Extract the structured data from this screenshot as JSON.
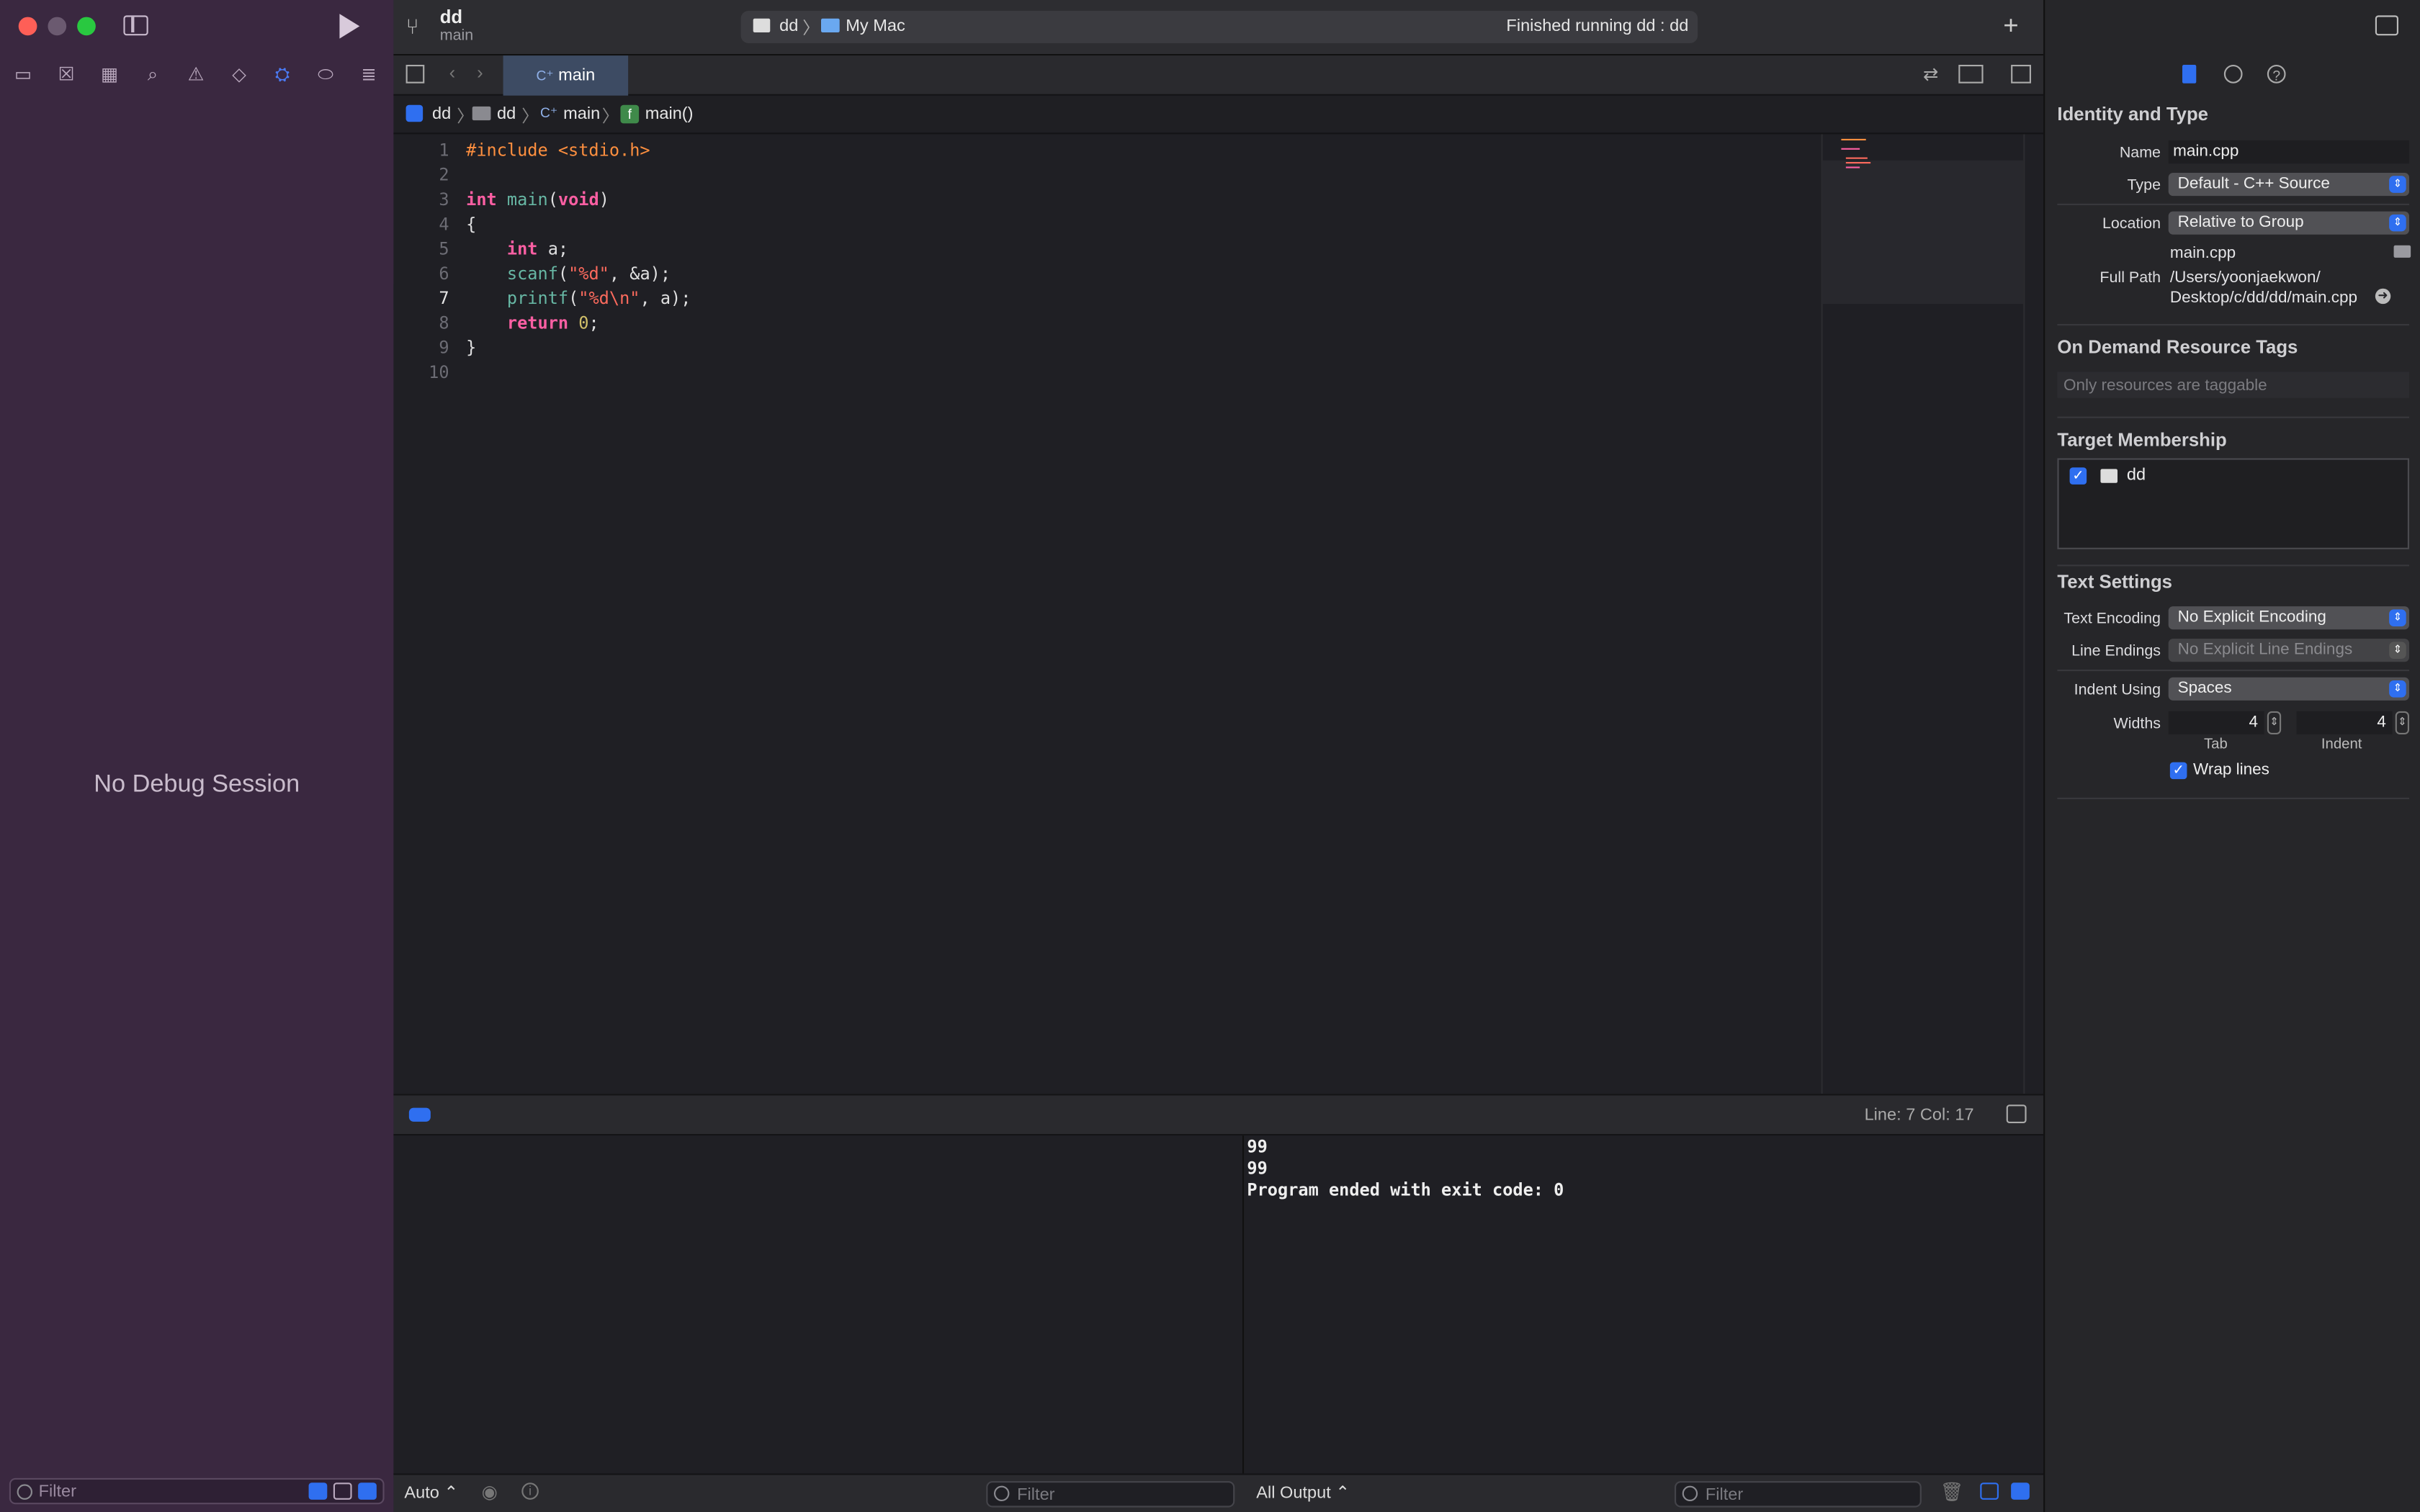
{
  "window": {
    "project": "dd",
    "branch": "main",
    "status": "Finished running dd : dd",
    "scheme": {
      "target": "dd",
      "destination": "My Mac"
    }
  },
  "left": {
    "no_debug": "No Debug Session",
    "filter_placeholder": "Filter"
  },
  "tab": {
    "label": "main"
  },
  "jumpbar": [
    "dd",
    "dd",
    "main",
    "main()"
  ],
  "editor": {
    "line_numbers": [
      "1",
      "2",
      "3",
      "4",
      "5",
      "6",
      "7",
      "8",
      "9",
      "10"
    ],
    "current_line": "7",
    "lines": [
      "#include <stdio.h>",
      "",
      "int main(void)",
      "{",
      "    int a;",
      "    scanf(\"%d\", &a);",
      "    printf(\"%d\\n\", a);",
      "    return 0;",
      "}",
      ""
    ]
  },
  "debugbar": {
    "position": "Line: 7  Col: 17"
  },
  "bottom": {
    "auto_label": "Auto ⌃",
    "var_filter_placeholder": "Filter",
    "output_select": "All Output ⌃",
    "console_filter_placeholder": "Filter",
    "console_lines": [
      "99",
      "99",
      "Program ended with exit code: 0"
    ]
  },
  "inspector": {
    "identity_title": "Identity and Type",
    "name_label": "Name",
    "name_value": "main.cpp",
    "type_label": "Type",
    "type_value": "Default - C++ Source",
    "location_label": "Location",
    "location_value": "Relative to Group",
    "file_name": "main.cpp",
    "fullpath_label": "Full Path",
    "fullpath_line1": "/Users/yoonjaekwon/",
    "fullpath_line2": "Desktop/c/dd/dd/main.cpp",
    "odr_title": "On Demand Resource Tags",
    "odr_placeholder": "Only resources are taggable",
    "target_title": "Target Membership",
    "target_item": "dd",
    "text_title": "Text Settings",
    "encoding_label": "Text Encoding",
    "encoding_value": "No Explicit Encoding",
    "endings_label": "Line Endings",
    "endings_value": "No Explicit Line Endings",
    "indent_label": "Indent Using",
    "indent_value": "Spaces",
    "widths_label": "Widths",
    "tab_width": "4",
    "indent_width": "4",
    "tab_caption": "Tab",
    "indent_caption": "Indent",
    "wrap_label": "Wrap lines"
  },
  "colors": {
    "accent": "#2f6ff0",
    "sidebar": "#3a2840",
    "editor_bg": "#1f1f24"
  }
}
